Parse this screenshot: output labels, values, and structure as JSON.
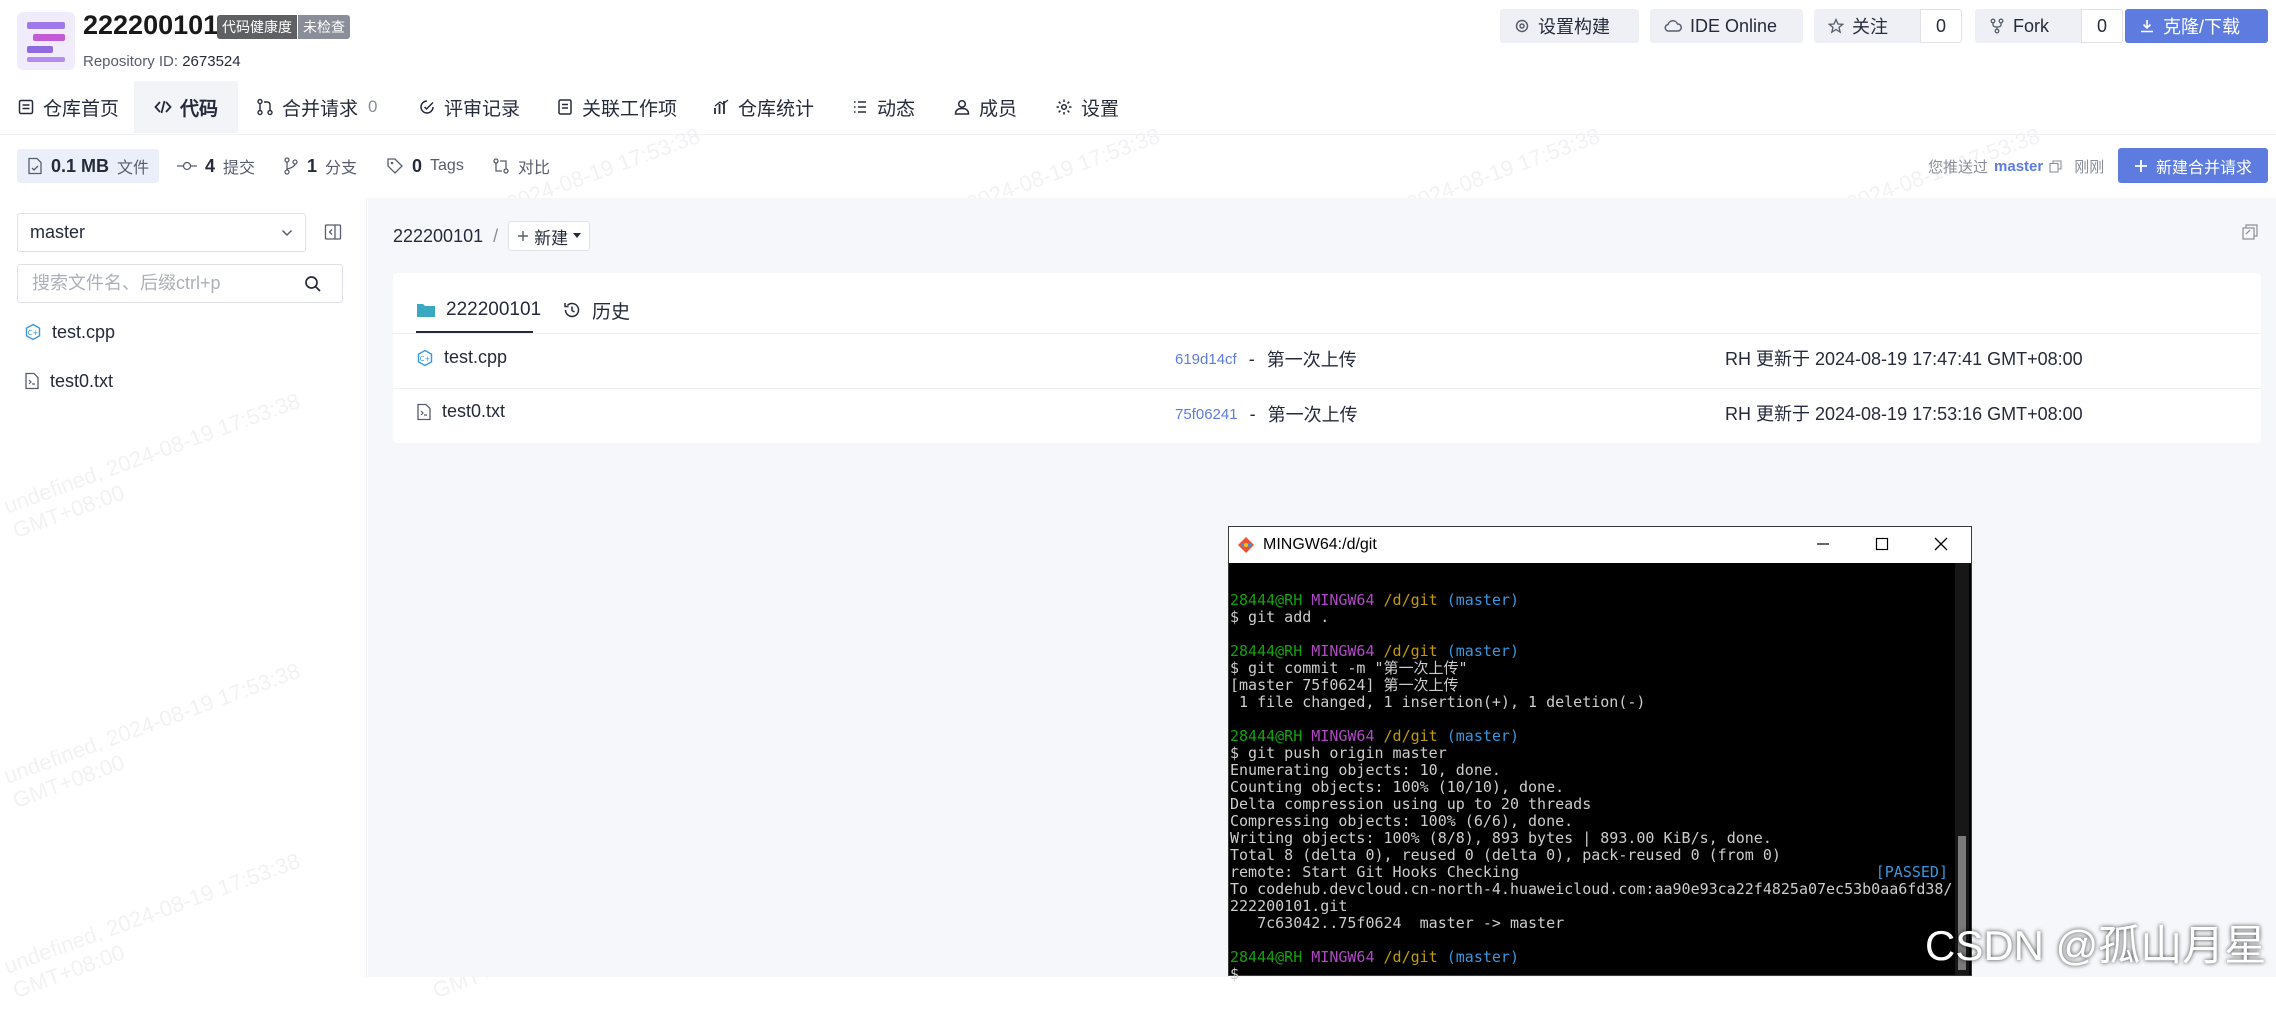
{
  "repo": {
    "name": "222200101",
    "badge_health": "代码健康度",
    "badge_status": "未检查",
    "id_label": "Repository ID:",
    "id_value": "2673524"
  },
  "header_buttons": {
    "build": "设置构建",
    "ide": "IDE Online",
    "follow": "关注",
    "follow_count": "0",
    "fork": "Fork",
    "fork_count": "0",
    "clone": "克隆/下载"
  },
  "tabs": [
    {
      "label": "仓库首页",
      "icon": "home-icon"
    },
    {
      "label": "代码",
      "icon": "code-icon"
    },
    {
      "label": "合并请求",
      "icon": "merge-icon",
      "count": "0"
    },
    {
      "label": "评审记录",
      "icon": "review-icon"
    },
    {
      "label": "关联工作项",
      "icon": "workitem-icon"
    },
    {
      "label": "仓库统计",
      "icon": "stats-icon"
    },
    {
      "label": "动态",
      "icon": "list-icon"
    },
    {
      "label": "成员",
      "icon": "user-icon"
    },
    {
      "label": "设置",
      "icon": "gear-icon"
    }
  ],
  "stats": {
    "size": "0.1 MB",
    "size_label": "文件",
    "commits": "4",
    "commits_label": "提交",
    "branches": "1",
    "branches_label": "分支",
    "tags": "0",
    "tags_label": "Tags",
    "compare_label": "对比"
  },
  "push_info": {
    "prefix": "您推送过",
    "branch": "master",
    "time": "刚刚",
    "new_mr": "新建合并请求"
  },
  "sidebar": {
    "branch": "master",
    "search_placeholder": "搜索文件名、后缀ctrl+p",
    "files": [
      "test.cpp",
      "test0.txt"
    ]
  },
  "breadcrumb": {
    "repo": "222200101",
    "sep": "/",
    "new_label": "新建"
  },
  "card": {
    "tab_files": "222200101",
    "tab_history": "历史",
    "rows": [
      {
        "name": "test.cpp",
        "icon": "cpp-file-icon",
        "hash": "619d14cf",
        "message": "第一次上传",
        "updated": "RH 更新于 2024-08-19 17:47:41 GMT+08:00"
      },
      {
        "name": "test0.txt",
        "icon": "text-file-icon",
        "hash": "75f06241",
        "message": "第一次上传",
        "updated": "RH 更新于 2024-08-19 17:53:16 GMT+08:00"
      }
    ],
    "dash": "-"
  },
  "watermark": {
    "line1": "undefined, 2024-08-19 17:53:38",
    "line2": "GMT+08:00"
  },
  "terminal": {
    "title": "MINGW64:/d/git",
    "prompt_user": "28444@RH",
    "prompt_env": "MINGW64",
    "prompt_path": "/d/git",
    "prompt_branch": "(master)",
    "cmd1": "$ git add .",
    "cmd2": "$ git commit -m \"第一次上传\"",
    "out2a": "[master 75f0624] 第一次上传",
    "out2b": " 1 file changed, 1 insertion(+), 1 deletion(-)",
    "cmd3": "$ git push origin master",
    "out3": [
      "Enumerating objects: 10, done.",
      "Counting objects: 100% (10/10), done.",
      "Delta compression using up to 20 threads",
      "Compressing objects: 100% (6/6), done.",
      "Writing objects: 100% (8/8), 893 bytes | 893.00 KiB/s, done.",
      "Total 8 (delta 0), reused 0 (delta 0), pack-reused 0 (from 0)"
    ],
    "remote": "remote: Start Git Hooks Checking",
    "passed": "[PASSED]",
    "to1": "To codehub.devcloud.cn-north-4.huaweicloud.com:aa90e93ca22f4825a07ec53b0aa6fd38/",
    "to2": "222200101.git",
    "to3": "   7c63042..75f0624  master -> master",
    "last": "$"
  },
  "watermark_brand": "CSDN @孤山月星"
}
